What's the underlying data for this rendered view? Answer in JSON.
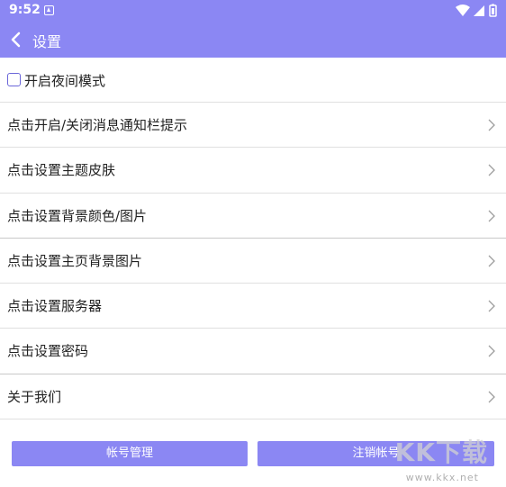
{
  "status_bar": {
    "time": "9:52"
  },
  "header": {
    "title": "设置"
  },
  "night_mode": {
    "label": "开启夜间模式",
    "checked": false
  },
  "menu": {
    "items": [
      {
        "label": "点击开启/关闭消息通知栏提示"
      },
      {
        "label": "点击设置主题皮肤"
      },
      {
        "label": "点击设置背景颜色/图片"
      },
      {
        "label": "点击设置主页背景图片"
      },
      {
        "label": "点击设置服务器"
      },
      {
        "label": "点击设置密码"
      },
      {
        "label": "关于我们"
      }
    ]
  },
  "buttons": {
    "account_manage": "帐号管理",
    "logout_account": "注销帐号"
  },
  "watermark": {
    "logo": "KK下载",
    "url": "www.kkx.net"
  },
  "colors": {
    "accent": "#8b87f3",
    "divider": "#e0e0e0"
  }
}
